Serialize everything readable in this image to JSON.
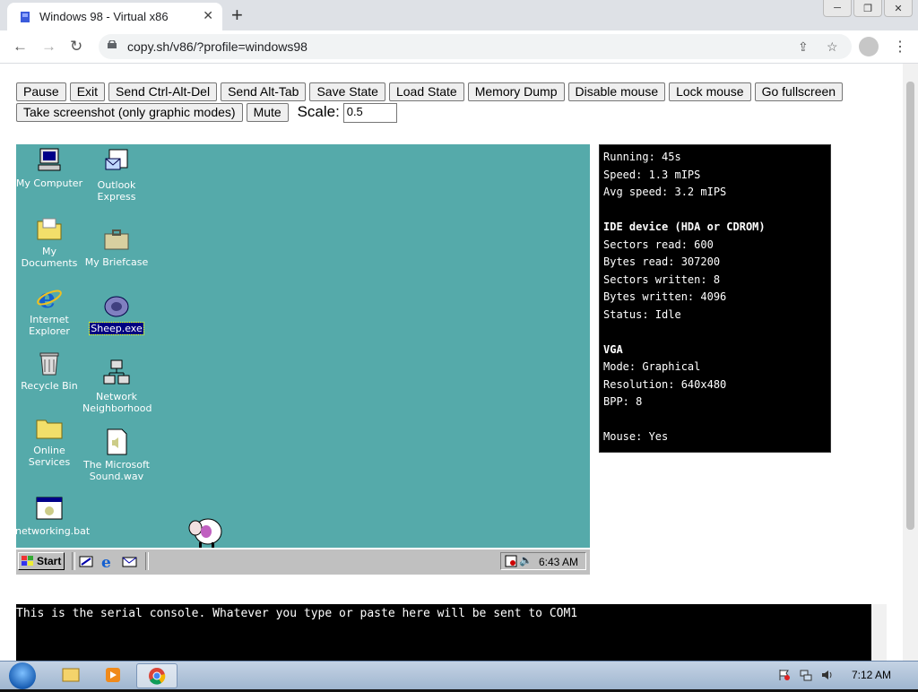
{
  "browser": {
    "tab_title": "Windows 98 - Virtual x86",
    "tab_close": "✕",
    "new_tab": "+",
    "url": "copy.sh/v86/?profile=windows98",
    "window_controls": [
      "─",
      "❐",
      "✕"
    ]
  },
  "v86": {
    "buttons_row1": [
      "Pause",
      "Exit",
      "Send Ctrl-Alt-Del",
      "Send Alt-Tab",
      "Save State",
      "Load State",
      "Memory Dump",
      "Disable mouse",
      "Lock mouse",
      "Go fullscreen"
    ],
    "buttons_row2": [
      "Take screenshot (only graphic modes)",
      "Mute"
    ],
    "scale_label": "Scale:",
    "scale_value": "0.5"
  },
  "desktop": {
    "icons_col1": [
      "My Computer",
      "My Documents",
      "Internet Explorer",
      "Recycle Bin",
      "Online Services",
      "networking.bat"
    ],
    "icons_col2": [
      "Outlook Express",
      "My Briefcase",
      "Sheep.exe",
      "Network Neighborhood",
      "The Microsoft Sound.wav"
    ],
    "start_label": "Start",
    "clock": "6:43 AM"
  },
  "stats": {
    "running": "Running: 45s",
    "speed": "Speed: 1.3 mIPS",
    "avg_speed": "Avg speed: 3.2 mIPS",
    "ide_header": "IDE device (HDA or CDROM)",
    "sectors_read": "Sectors read: 600",
    "bytes_read": "Bytes read: 307200",
    "sectors_written": "Sectors written: 8",
    "bytes_written": "Bytes written: 4096",
    "status": "Status: Idle",
    "vga_header": "VGA",
    "mode": "Mode: Graphical",
    "resolution": "Resolution: 640x480",
    "bpp": "BPP: 8",
    "mouse": "Mouse: Yes"
  },
  "serial": {
    "text": "This is the serial console. Whatever you type or paste here will be sent to COM1"
  },
  "os_taskbar": {
    "clock": "7:12 AM"
  }
}
